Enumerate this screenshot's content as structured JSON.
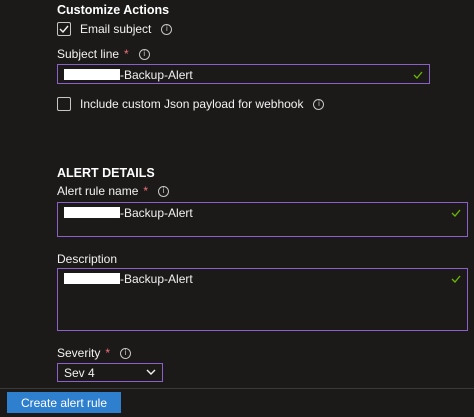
{
  "customize_actions": {
    "title": "Customize Actions",
    "email_subject": {
      "label": "Email subject",
      "checked": true,
      "info_icon": "info-icon"
    },
    "subject_line": {
      "label": "Subject line",
      "required_mark": "*",
      "value_suffix": "-Backup-Alert",
      "valid_icon": "checkmark-icon"
    },
    "include_custom_json": {
      "label": "Include custom Json payload for webhook",
      "checked": false
    }
  },
  "alert_details": {
    "title": "ALERT DETAILS",
    "alert_rule_name": {
      "label": "Alert rule name",
      "required_mark": "*",
      "value_suffix": "-Backup-Alert"
    },
    "description": {
      "label": "Description",
      "value_suffix": "-Backup-Alert"
    },
    "severity": {
      "label": "Severity",
      "required_mark": "*",
      "selected": "Sev 4"
    }
  },
  "footer": {
    "create_button": "Create alert rule"
  },
  "colors": {
    "background": "#1b1a19",
    "accent_border": "#8a60c9",
    "primary": "#2f7fcf",
    "valid": "#6bb700",
    "required": "#f1707b"
  }
}
